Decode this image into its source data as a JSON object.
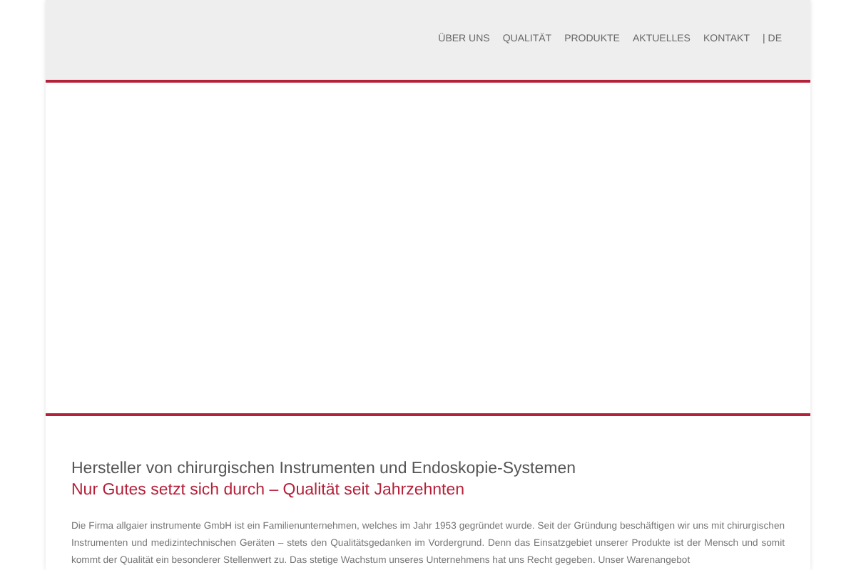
{
  "nav": {
    "items": [
      {
        "label": "ÜBER UNS"
      },
      {
        "label": "QUALITÄT"
      },
      {
        "label": "PRODUKTE"
      },
      {
        "label": "AKTUELLES"
      },
      {
        "label": "KONTAKT"
      },
      {
        "label": "| DE"
      }
    ]
  },
  "intro": {
    "heading": "Hersteller von chirurgischen Instrumenten und Endoskopie-Systemen",
    "subheading": "Nur Gutes setzt sich durch – Qualität seit Jahrzehnten",
    "paragraph": "Die Firma allgaier instrumente GmbH ist ein Familienunternehmen, welches im Jahr 1953 gegründet wurde. Seit der Gründung beschäftigen wir uns mit chirurgischen Instrumenten und medizintechnischen Geräten – stets den Qualitätsgedanken im Vordergrund. Denn das Einsatzgebiet unserer Produkte ist der Mensch und somit kommt der Qualität ein besonderer Stellenwert zu. Das stetige Wachstum unseres Unternehmens hat uns Recht gegeben. Unser Warenangebot"
  }
}
